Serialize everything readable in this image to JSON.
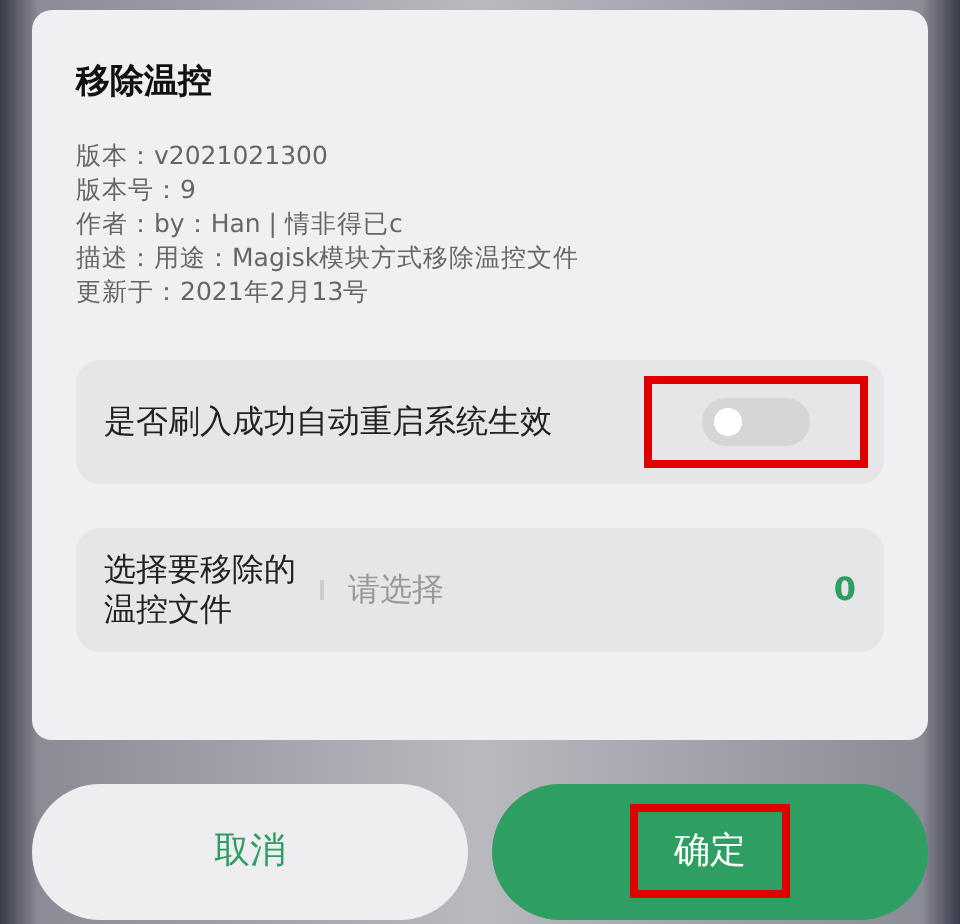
{
  "dialog": {
    "title": "移除温控",
    "info": [
      "版本：v2021021300",
      "版本号：9",
      "作者：by：Han | 情非得已c",
      "描述：用途：Magisk模块方式移除温控文件",
      "更新于：2021年2月13号"
    ],
    "toggle_row": {
      "label": "是否刷入成功自动重启系统生效",
      "on": false,
      "highlighted": true
    },
    "select_row": {
      "label": "选择要移除的温控文件",
      "placeholder": "请选择",
      "count": "0"
    }
  },
  "buttons": [
    {
      "label": "取消",
      "kind": "secondary",
      "highlighted": false
    },
    {
      "label": "确定",
      "kind": "primary",
      "highlighted": true
    }
  ]
}
